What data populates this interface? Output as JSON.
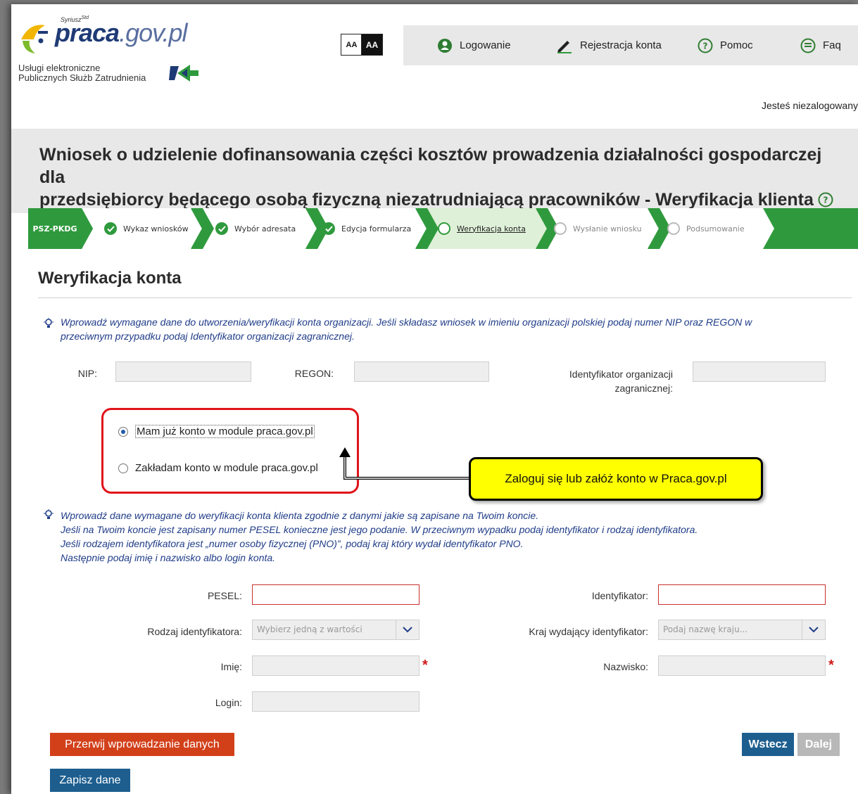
{
  "header": {
    "logo_small": "Syriusz",
    "logo_small_sup": "Std",
    "logo_main": "praca",
    "logo_domain": ".gov.pl",
    "subtitle_line1": "Usługi elektroniczne",
    "subtitle_line2": "Publicznych Służb Zatrudnienia",
    "font_small": "AA",
    "font_large": "AA",
    "nav": {
      "login": "Logowanie",
      "register": "Rejestracja konta",
      "help": "Pomoc",
      "faq": "Faq"
    },
    "login_status": "Jesteś niezalogowany"
  },
  "page_title_line1": "Wniosek o udzielenie dofinansowania części kosztów prowadzenia działalności gospodarczej dla",
  "page_title_line2": "przedsiębiorcy będącego osobą fizyczną niezatrudniającą pracowników - Weryfikacja klienta",
  "steps": {
    "badge": "PSZ-PKDG",
    "items": [
      {
        "label": "Wykaz wniosków",
        "state": "done"
      },
      {
        "label": "Wybór adresata",
        "state": "done"
      },
      {
        "label": "Edycja formularza",
        "state": "done"
      },
      {
        "label": "Weryfikacja konta",
        "state": "current"
      },
      {
        "label": "Wysłanie wniosku",
        "state": "pending"
      },
      {
        "label": "Podsumowanie",
        "state": "pending"
      }
    ]
  },
  "section_title": "Weryfikacja konta",
  "info1_line1": "Wprowadź wymagane dane do utworzenia/weryfikacji konta organizacji. Jeśli składasz wniosek w imieniu organizacji polskiej podaj numer NIP oraz REGON w",
  "info1_line2": "przeciwnym przypadku podaj Identyfikator organizacji zagranicznej.",
  "org": {
    "nip_label": "NIP:",
    "regon_label": "REGON:",
    "foreign_label_1": "Identyfikator organizacji",
    "foreign_label_2": "zagranicznej:"
  },
  "account": {
    "has_account": "Mam już konto w module praca.gov.pl",
    "create_account": "Zakładam konto w module praca.gov.pl",
    "selected": "has_account"
  },
  "callout": "Zaloguj się lub załóż konto w Praca.gov.pl",
  "info2_lines": [
    "Wprowadź dane wymagane do weryfikacji konta klienta zgodnie z danymi jakie są zapisane na Twoim koncie.",
    "Jeśli na Twoim koncie jest zapisany numer PESEL konieczne jest jego podanie. W przeciwnym wypadku podaj identyfikator i rodzaj identyfikatora.",
    "Jeśli rodzajem identyfikatora jest „numer osoby fizycznej (PNO)”, podaj kraj który wydał identyfikator PNO.",
    "Następnie podaj imię i nazwisko albo login konta."
  ],
  "client": {
    "pesel_label": "PESEL:",
    "identifier_label": "Identyfikator:",
    "id_type_label": "Rodzaj identyfikatora:",
    "id_type_placeholder": "Wybierz jedną z wartości",
    "country_label": "Kraj wydający identyfikator:",
    "country_placeholder": "Podaj nazwę kraju...",
    "first_name_label": "Imię:",
    "last_name_label": "Nazwisko:",
    "login_label": "Login:",
    "required_mark": "*"
  },
  "buttons": {
    "abort": "Przerwij wprowadzanie danych",
    "back": "Wstecz",
    "next": "Dalej",
    "save": "Zapisz dane"
  },
  "colors": {
    "brand_blue": "#1f3b76",
    "step_green": "#2f9a3d",
    "info_blue": "#1f3c88",
    "abort_red": "#d2401a",
    "button_blue": "#1d5e8f",
    "disabled_gray": "#b8b8b8",
    "callout_yellow": "#ffff00",
    "highlight_red": "#e0131a"
  }
}
